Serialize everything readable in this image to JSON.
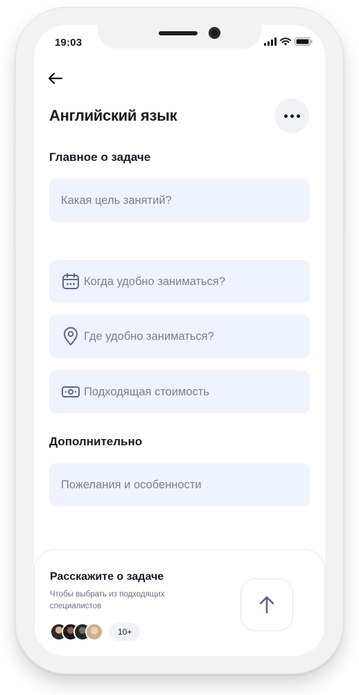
{
  "status_bar": {
    "time": "19:03",
    "icons": [
      "signal-icon",
      "wifi-icon",
      "battery-icon"
    ]
  },
  "header": {
    "back_icon": "arrow-left-icon",
    "title": "Английский язык",
    "more_icon": "more-horizontal-icon"
  },
  "main_section": {
    "title": "Главное о задаче",
    "goal_placeholder": "Какая цель занятий?"
  },
  "fields": [
    {
      "icon": "calendar-icon",
      "placeholder": "Когда удобно заниматься?"
    },
    {
      "icon": "location-pin-icon",
      "placeholder": "Где удобно заниматься?"
    },
    {
      "icon": "money-icon",
      "placeholder": "Подходящая стоимость"
    }
  ],
  "extra_section": {
    "title": "Дополнительно",
    "wishes_placeholder": "Пожелания и особенности"
  },
  "bottom_card": {
    "title": "Расскажите о задаче",
    "subtitle": "Чтобы выбрать из подходящих специалистов",
    "count_badge": "10+",
    "send_icon": "arrow-up-icon"
  },
  "colors": {
    "field_bg": "#eef3fe",
    "placeholder_text": "#7b7f90",
    "icon_stroke": "#5f6786",
    "text_primary": "#1a1a24"
  }
}
